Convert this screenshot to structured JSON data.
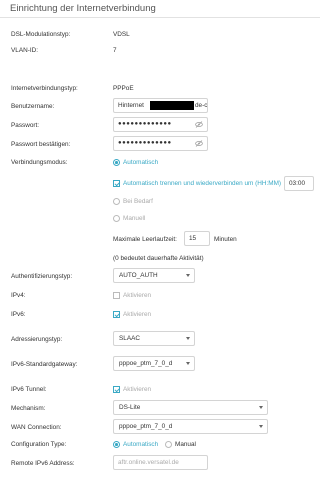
{
  "page_title": "Einrichtung der Internetverbindung",
  "dsl": {
    "label": "DSL-Modulationstyp:",
    "value": "VDSL"
  },
  "vlan": {
    "label": "VLAN-ID:",
    "value": "7"
  },
  "conn_type": {
    "label": "Internetverbindungstyp:",
    "value": "PPPoE"
  },
  "username": {
    "label": "Benutzername:",
    "value_prefix": "Hinternet",
    "value_suffix": "de-c"
  },
  "password": {
    "label": "Passwort:",
    "value": "●●●●●●●●●●●●●"
  },
  "password_confirm": {
    "label": "Passwort bestätigen:",
    "value": "●●●●●●●●●●●●●"
  },
  "eye_icon_glyph": "ⓘ",
  "conn_mode": {
    "label": "Verbindungsmodus:",
    "options": {
      "auto": "Automatisch",
      "auto_disconnect": "Automatisch trennen und wiederverbinden um (HH:MM)",
      "on_demand": "Bei Bedarf",
      "manual": "Manuell"
    },
    "time_value": "03:00",
    "idle_label": "Maximale Leerlaufzeit:",
    "idle_value": "15",
    "idle_unit": "Minuten",
    "idle_note": "(0 bedeutet dauerhafte Aktivität)"
  },
  "auth_type": {
    "label": "Authentifizierungstyp:",
    "value": "AUTO_AUTH"
  },
  "ipv4": {
    "label": "IPv4:",
    "option": "Aktivieren"
  },
  "ipv6": {
    "label": "IPv6:",
    "option": "Aktivieren"
  },
  "addr_type": {
    "label": "Adressierungstyp:",
    "value": "SLAAC"
  },
  "ipv6_gateway": {
    "label": "IPv6-Standardgateway:",
    "value": "pppoe_ptm_7_0_d"
  },
  "ipv6_tunnel": {
    "label": "IPv6 Tunnel:",
    "option": "Aktivieren"
  },
  "mechanism": {
    "label": "Mechanism:",
    "value": "DS-Lite"
  },
  "wan_connection": {
    "label": "WAN Connection:",
    "value": "pppoe_ptm_7_0_d"
  },
  "config_type": {
    "label": "Configuration Type:",
    "options": {
      "auto": "Automatisch",
      "manual": "Manual"
    }
  },
  "remote_ipv6": {
    "label": "Remote IPv6 Address:",
    "placeholder": "aftr.online.versatel.de"
  },
  "colors": {
    "accent": "#3aa9c5",
    "text": "#333333",
    "muted": "#aaaaaa",
    "border": "#d4d4d4"
  }
}
